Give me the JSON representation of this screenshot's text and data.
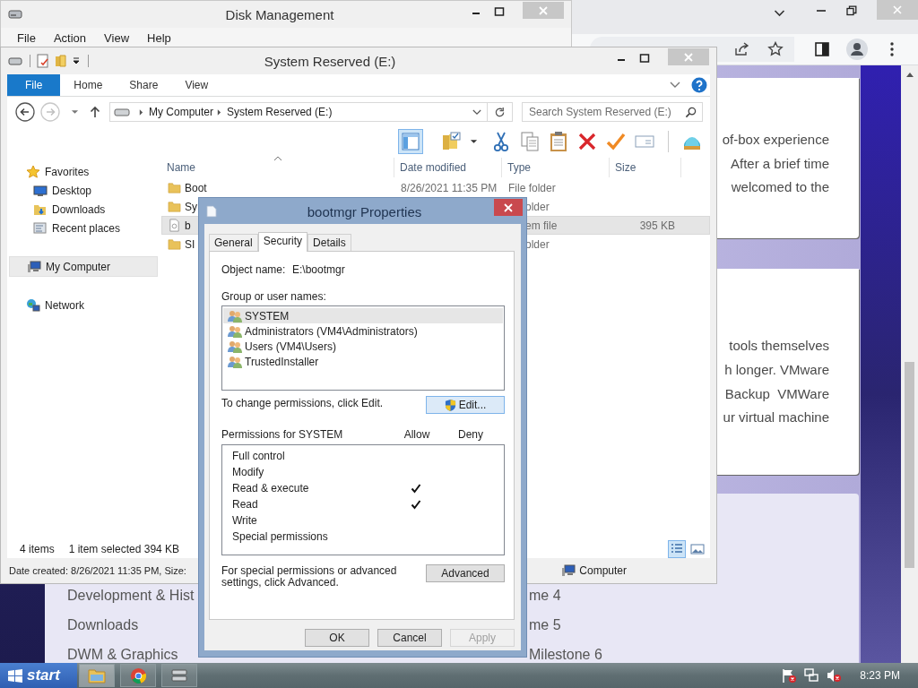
{
  "browser": {
    "cards": [
      {
        "lines": [
          "of-box experience",
          "After a brief time",
          "welcomed to the"
        ]
      },
      {
        "lines": [
          "tools themselves",
          "h longer. VMware",
          "Backup  VMWare",
          "ur virtual machine"
        ]
      }
    ],
    "nav_links": [
      "Development & Hist",
      "Downloads",
      "DWM & Graphics"
    ],
    "milestones": [
      "me 4",
      "me 5",
      "Milestone 6"
    ]
  },
  "disk_management": {
    "title": "Disk Management",
    "menu": [
      "File",
      "Action",
      "View",
      "Help"
    ]
  },
  "explorer": {
    "title": "System Reserved (E:)",
    "ribbon_tabs": [
      {
        "label": "File",
        "selected": true
      },
      {
        "label": "Home",
        "selected": false
      },
      {
        "label": "Share",
        "selected": false
      },
      {
        "label": "View",
        "selected": false
      }
    ],
    "breadcrumb": [
      "My Computer",
      "System Reserved (E:)"
    ],
    "search": {
      "placeholder": "Search System Reserved (E:)"
    },
    "navigation": [
      {
        "label": "Favorites",
        "selected": false,
        "children": [
          {
            "label": "Desktop",
            "selected": false
          },
          {
            "label": "Downloads",
            "selected": false
          },
          {
            "label": "Recent places",
            "selected": false
          }
        ]
      },
      {
        "label": "My Computer",
        "selected": true
      },
      {
        "label": "Network",
        "selected": false
      }
    ],
    "columns": [
      "Name",
      "Date modified",
      "Type",
      "Size"
    ],
    "rows": [
      {
        "name": "Boot",
        "date": "8/26/2021 11:35 PM",
        "type": "File folder",
        "kind": "folder",
        "covered": false,
        "selected": false
      },
      {
        "name": "Sy",
        "type": "older",
        "kind": "folder",
        "covered": true,
        "selected": false
      },
      {
        "name": "b",
        "type": "em file",
        "size": "395 KB",
        "kind": "file",
        "covered": true,
        "selected": true
      },
      {
        "name": "SI",
        "type": "older",
        "kind": "folder",
        "covered": true,
        "selected": false
      }
    ],
    "status": {
      "count": "4 items",
      "selection": "1 item selected  394 KB"
    },
    "details": {
      "text": "Date created: 8/26/2021 11:35 PM, Size:",
      "location": "Computer"
    }
  },
  "properties_dialog": {
    "title": "bootmgr Properties",
    "tabs": [
      {
        "label": "General",
        "selected": false
      },
      {
        "label": "Security",
        "selected": true
      },
      {
        "label": "Details",
        "selected": false
      }
    ],
    "object_name_label": "Object name:",
    "object_name": "E:\\bootmgr",
    "groups_label": "Group or user names:",
    "users": [
      {
        "name": "SYSTEM",
        "selected": true
      },
      {
        "name": "Administrators (VM4\\Administrators)",
        "selected": false
      },
      {
        "name": "Users (VM4\\Users)",
        "selected": false
      },
      {
        "name": "TrustedInstaller",
        "selected": false
      }
    ],
    "change_hint": "To change permissions, click Edit.",
    "edit_button": "Edit...",
    "permissions_label": "Permissions for SYSTEM",
    "allow_label": "Allow",
    "deny_label": "Deny",
    "permissions": [
      {
        "name": "Full control",
        "allow": false,
        "deny": false
      },
      {
        "name": "Modify",
        "allow": false,
        "deny": false
      },
      {
        "name": "Read & execute",
        "allow": true,
        "deny": false
      },
      {
        "name": "Read",
        "allow": true,
        "deny": false
      },
      {
        "name": "Write",
        "allow": false,
        "deny": false
      },
      {
        "name": "Special permissions",
        "allow": false,
        "deny": false
      }
    ],
    "advanced_hint": "For special permissions or advanced settings, click Advanced.",
    "advanced_button": "Advanced",
    "buttons": [
      {
        "label": "OK",
        "disabled": false
      },
      {
        "label": "Cancel",
        "disabled": false
      },
      {
        "label": "Apply",
        "disabled": true
      }
    ]
  },
  "taskbar": {
    "start": "start",
    "time": "8:23 PM"
  }
}
